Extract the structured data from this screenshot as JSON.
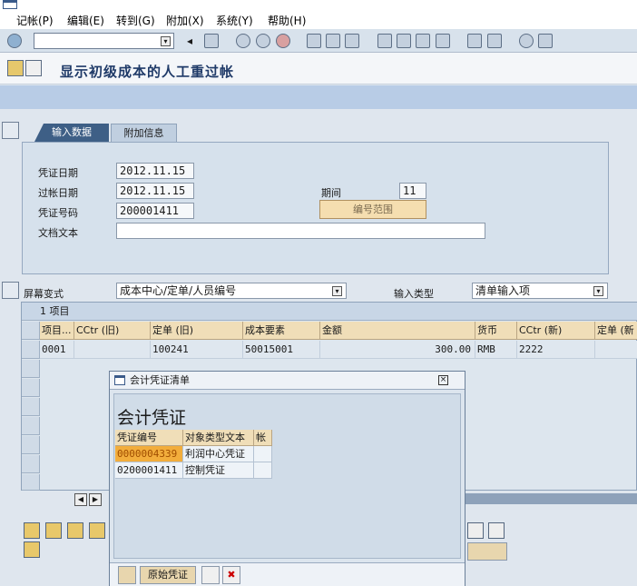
{
  "menu": [
    "记帐(P)",
    "编辑(E)",
    "转到(G)",
    "附加(X)",
    "系统(Y)",
    "帮助(H)"
  ],
  "toolbar": {
    "command_value": ""
  },
  "title": "显示初级成本的人工重过帐",
  "tabs": [
    "输入数据",
    "附加信息"
  ],
  "header": {
    "doc_date_label": "凭证日期",
    "doc_date": "2012.11.15",
    "posting_date_label": "过帐日期",
    "posting_date": "2012.11.15",
    "doc_no_label": "凭证号码",
    "doc_no": "200001411",
    "doc_text_label": "文档文本",
    "doc_text": "",
    "period_label": "期间",
    "period": "11",
    "range_button": "编号范围"
  },
  "screen_variant": {
    "label": "屏幕变式",
    "value": "成本中心/定单/人员编号"
  },
  "input_type": {
    "label": "输入类型",
    "value": "清单输入项"
  },
  "grid": {
    "title": "1 项目",
    "columns": [
      "项目...",
      "CCtr (旧)",
      "定单 (旧)",
      "成本要素",
      "金额",
      "货币",
      "CCtr (新)",
      "定单 (新"
    ],
    "rows": [
      [
        "0001",
        "",
        "100241",
        "50015001",
        "300.00",
        "RMB",
        "2222",
        ""
      ]
    ]
  },
  "popup": {
    "title": "会计凭证清单",
    "heading": "会计凭证",
    "columns": [
      "凭证编号",
      "对象类型文本",
      "帐"
    ],
    "rows": [
      [
        "0000004339",
        "利润中心凭证",
        ""
      ],
      [
        "0200001411",
        "控制凭证",
        ""
      ]
    ],
    "orig_button": "原始凭证"
  }
}
